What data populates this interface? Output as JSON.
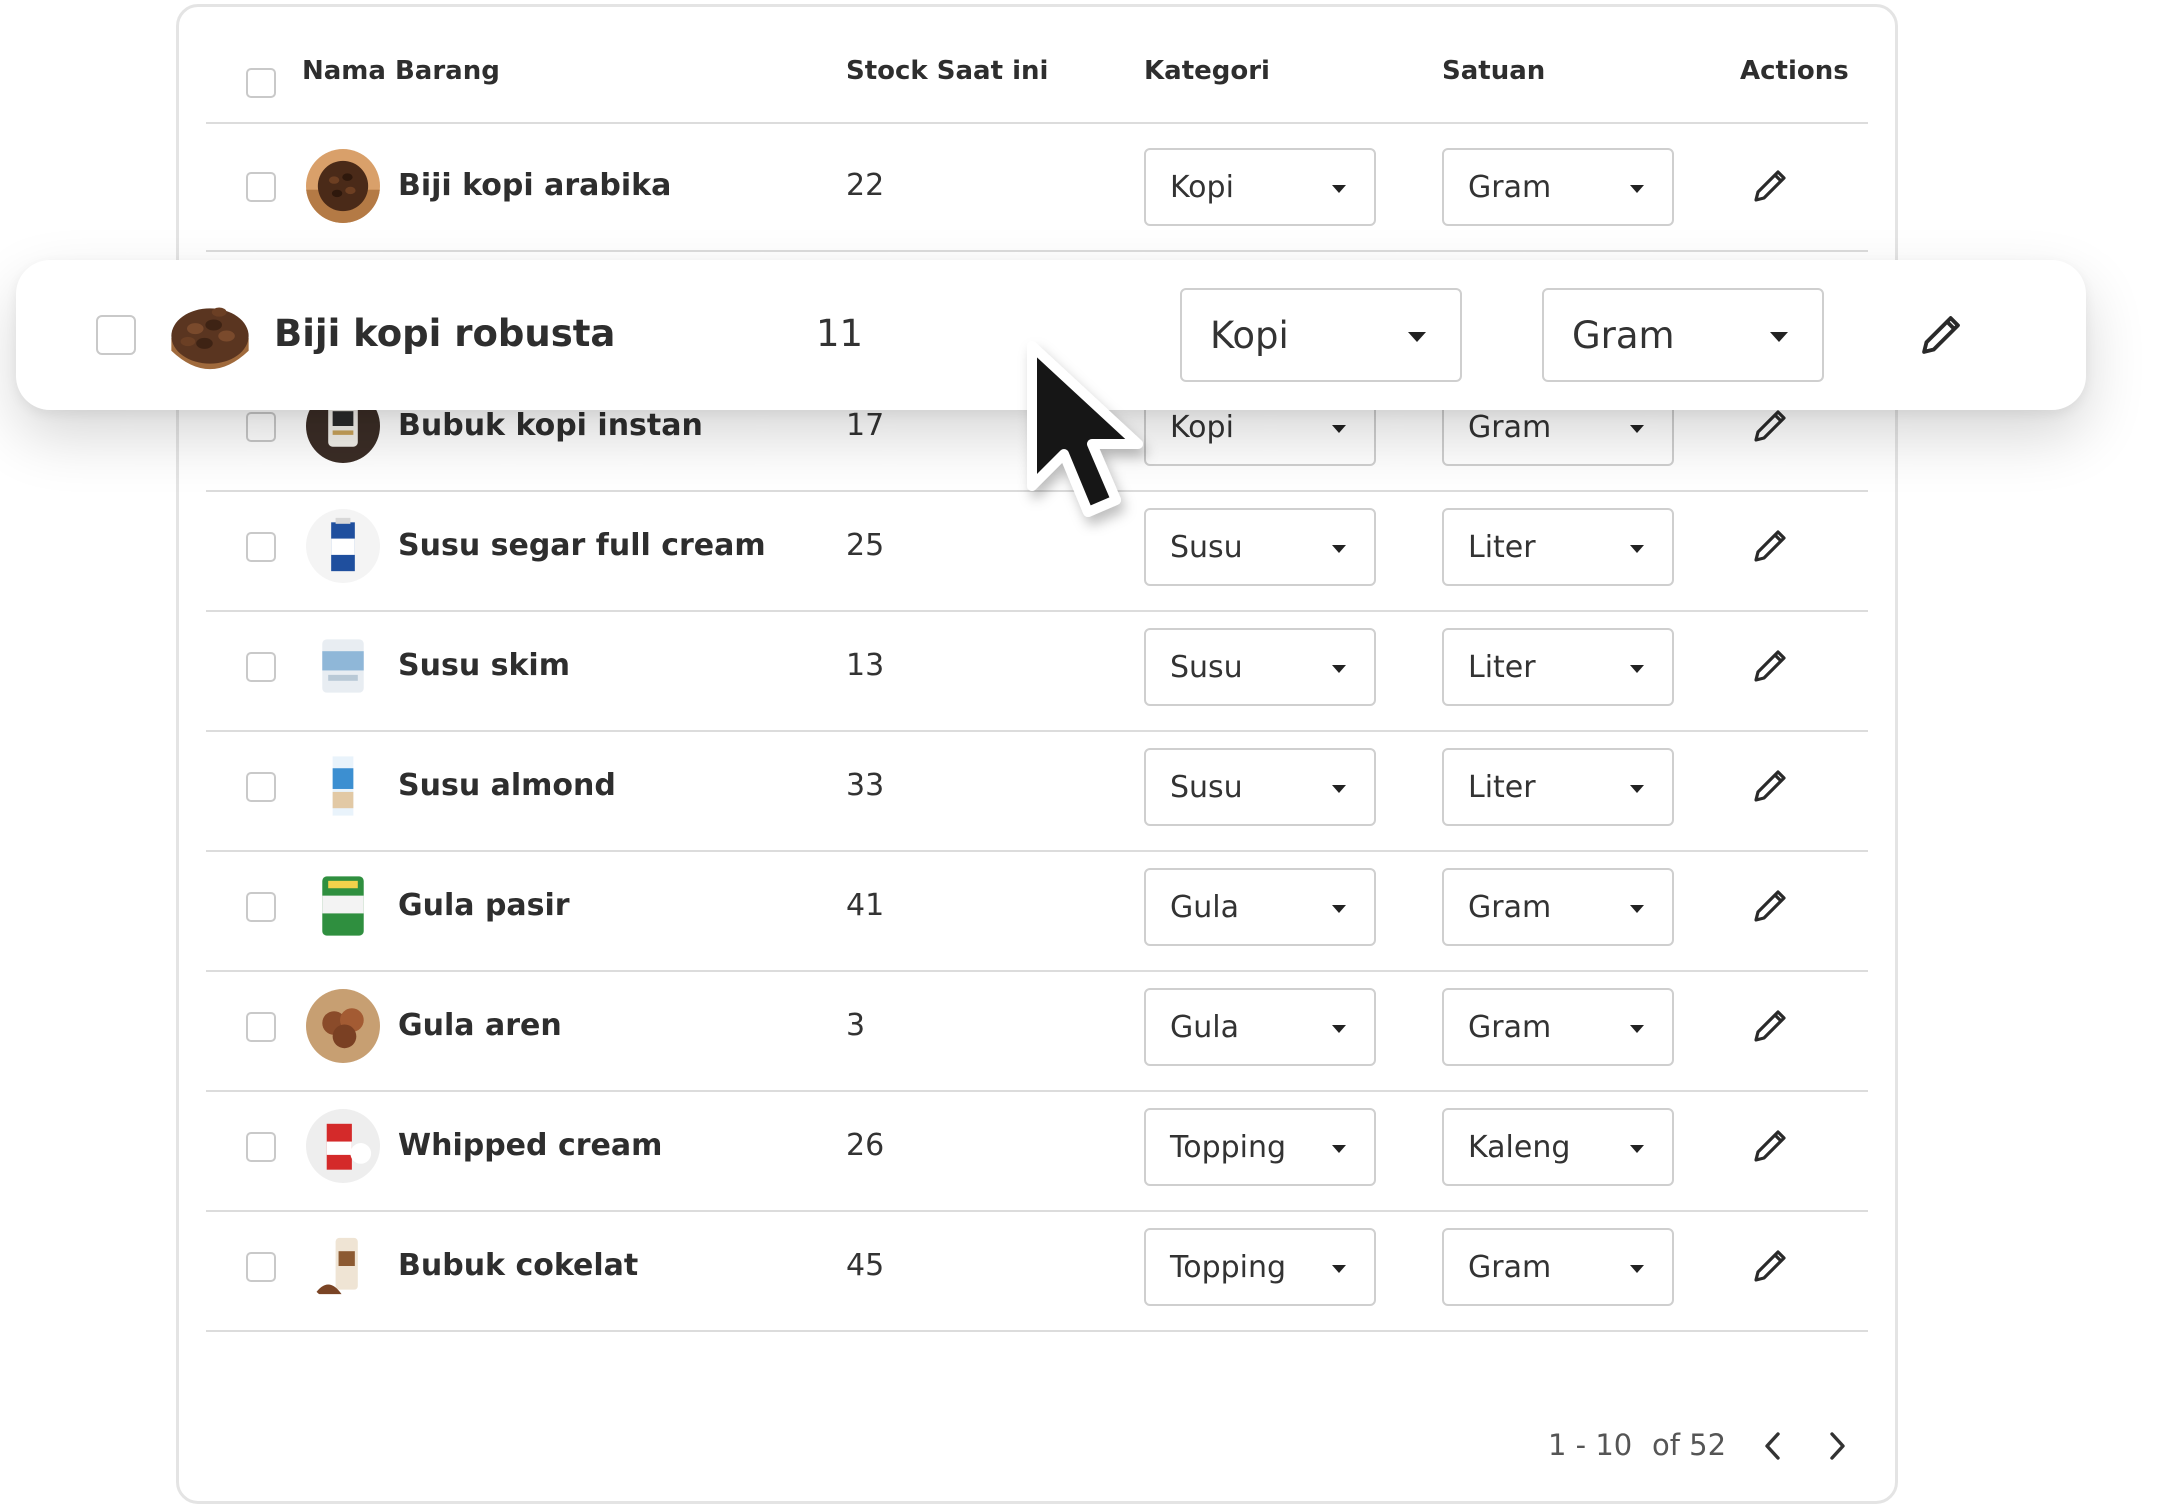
{
  "columns": {
    "name": "Nama Barang",
    "stock": "Stock Saat ini",
    "category": "Kategori",
    "unit": "Satuan",
    "actions": "Actions"
  },
  "rows": [
    {
      "name": "Biji kopi arabika",
      "stock": "22",
      "category": "Kopi",
      "unit": "Gram"
    },
    {
      "name": "Bubuk kopi instan",
      "stock": "17",
      "category": "Kopi",
      "unit": "Gram"
    },
    {
      "name": "Susu segar full cream",
      "stock": "25",
      "category": "Susu",
      "unit": "Liter"
    },
    {
      "name": "Susu skim",
      "stock": "13",
      "category": "Susu",
      "unit": "Liter"
    },
    {
      "name": "Susu almond",
      "stock": "33",
      "category": "Susu",
      "unit": "Liter"
    },
    {
      "name": "Gula pasir",
      "stock": "41",
      "category": "Gula",
      "unit": "Gram"
    },
    {
      "name": "Gula aren",
      "stock": "3",
      "category": "Gula",
      "unit": "Gram"
    },
    {
      "name": "Whipped cream",
      "stock": "26",
      "category": "Topping",
      "unit": "Kaleng"
    },
    {
      "name": "Bubuk cokelat",
      "stock": "45",
      "category": "Topping",
      "unit": "Gram"
    }
  ],
  "dragged_row": {
    "name": "Biji kopi robusta",
    "stock": "11",
    "category": "Kopi",
    "unit": "Gram"
  },
  "pagination": {
    "range": "1 - 10",
    "total": "of 52"
  },
  "icons": {
    "edit": "pencil-icon",
    "prev": "chevron-left-icon",
    "next": "chevron-right-icon",
    "cursor": "mouse-pointer-icon"
  },
  "colors": {
    "border": "#dcdcdc",
    "text": "#2e2e2e"
  }
}
